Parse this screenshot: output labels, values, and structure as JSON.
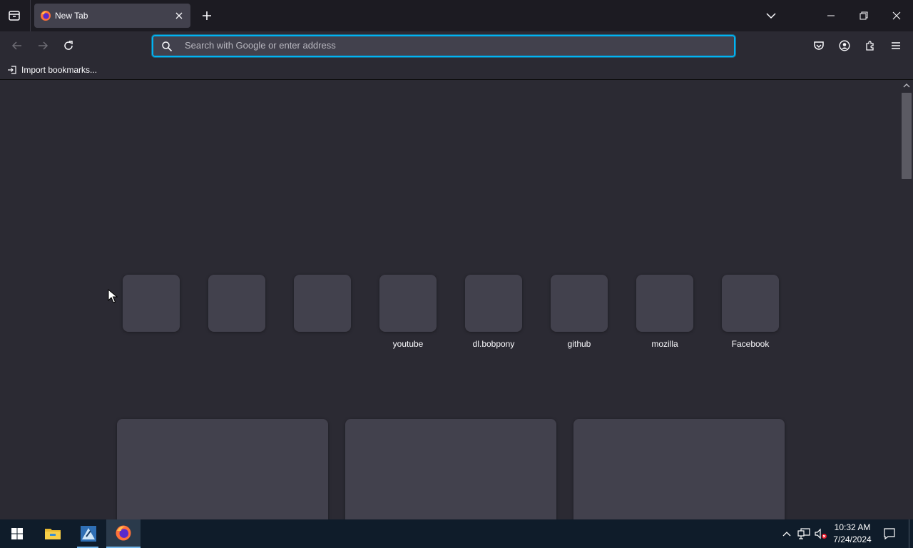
{
  "browser": {
    "tab": {
      "title": "New Tab"
    },
    "urlbar": {
      "placeholder": "Search with Google or enter address"
    },
    "bookmarks": {
      "import_label": "Import bookmarks..."
    }
  },
  "shortcuts": [
    {
      "label": ""
    },
    {
      "label": ""
    },
    {
      "label": ""
    },
    {
      "label": "youtube"
    },
    {
      "label": "dl.bobpony"
    },
    {
      "label": "github"
    },
    {
      "label": "mozilla"
    },
    {
      "label": "Facebook"
    }
  ],
  "taskbar": {
    "time": "10:32 AM",
    "date": "7/24/2024"
  },
  "colors": {
    "accent": "#00b3f4",
    "toolbar": "#2b2a33",
    "tabstrip": "#1c1b22",
    "tile": "#42414d"
  },
  "icons": [
    "tab-list-icon",
    "firefox-icon",
    "close-icon",
    "plus-icon",
    "chevron-down-icon",
    "minimize-icon",
    "restore-icon",
    "window-close-icon",
    "back-arrow-icon",
    "forward-arrow-icon",
    "reload-icon",
    "search-icon",
    "pocket-icon",
    "account-icon",
    "extensions-icon",
    "menu-icon",
    "import-icon",
    "windows-start-icon",
    "file-explorer-icon",
    "app-icon",
    "firefox-taskbar-icon",
    "chevron-up-icon",
    "network-icon",
    "volume-muted-icon",
    "notification-icon"
  ]
}
